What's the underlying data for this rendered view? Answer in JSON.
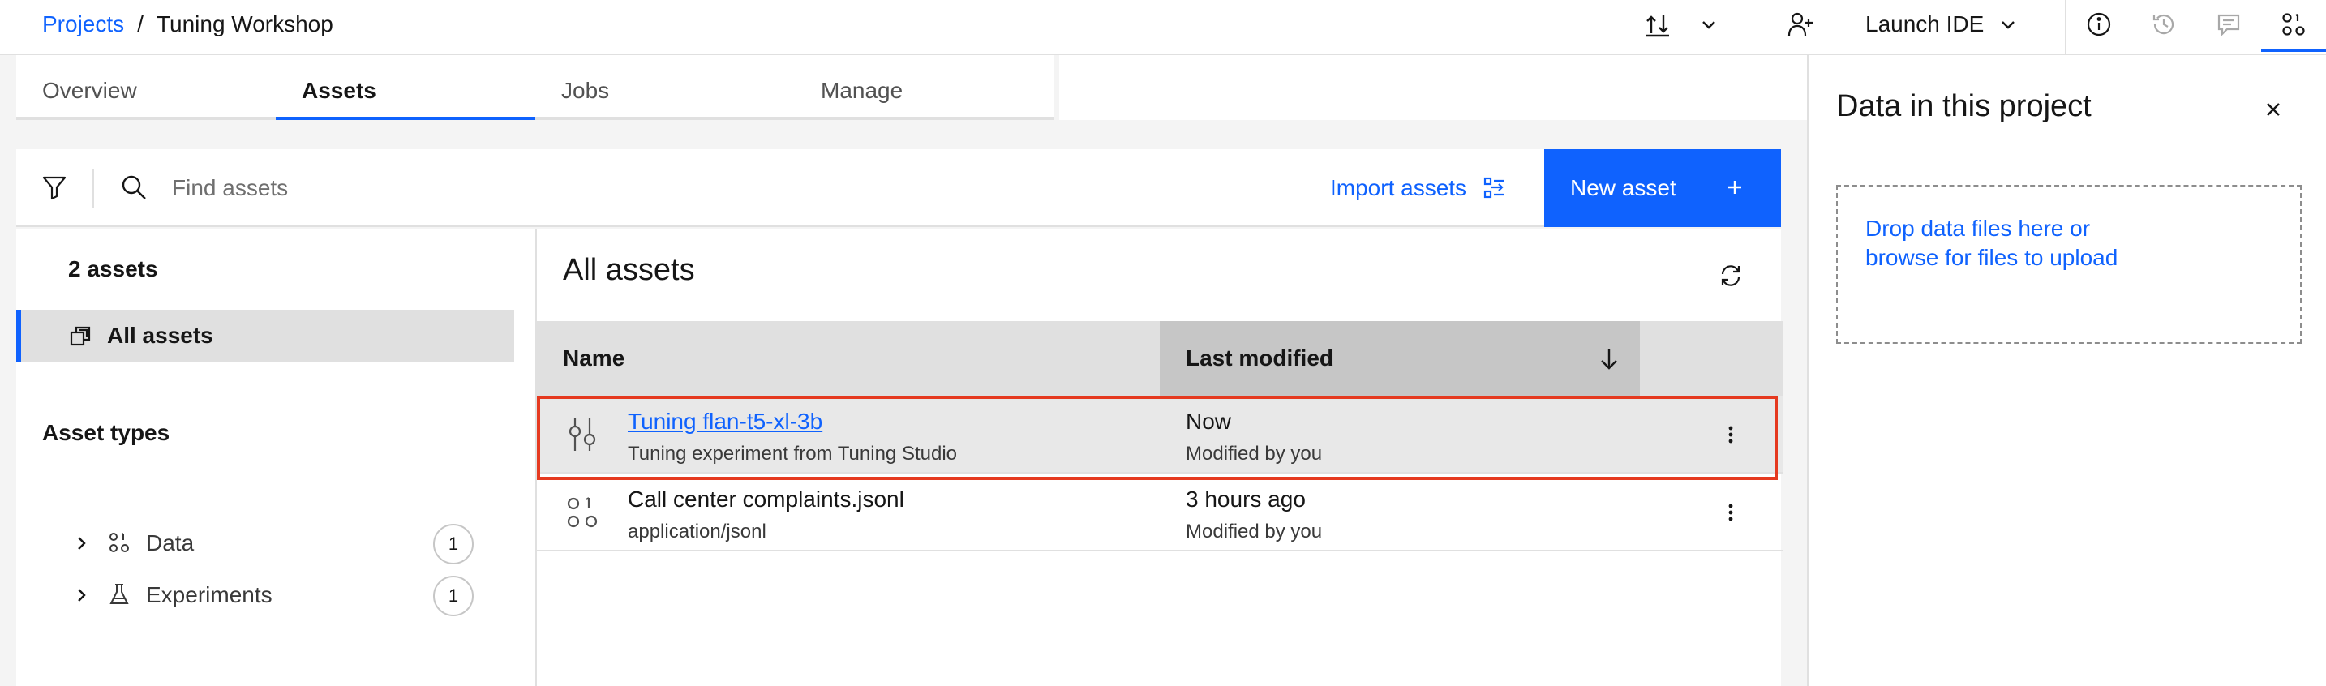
{
  "header": {
    "breadcrumb_root": "Projects",
    "breadcrumb_sep": "/",
    "project_name": "Tuning Workshop",
    "launch_label": "Launch IDE"
  },
  "tabs": [
    {
      "label": "Overview",
      "active": false
    },
    {
      "label": "Assets",
      "active": true
    },
    {
      "label": "Jobs",
      "active": false
    },
    {
      "label": "Manage",
      "active": false
    }
  ],
  "toolbar": {
    "search_placeholder": "Find assets",
    "import_label": "Import assets",
    "new_label": "New asset"
  },
  "sidebar": {
    "count": "2 assets",
    "all_assets": "All assets",
    "types_heading": "Asset types",
    "types": [
      {
        "label": "Data",
        "count": "1",
        "icon": "data-icon"
      },
      {
        "label": "Experiments",
        "count": "1",
        "icon": "flask-icon"
      }
    ]
  },
  "content": {
    "title": "All assets",
    "columns": {
      "name": "Name",
      "modified": "Last modified"
    },
    "rows": [
      {
        "name": "Tuning flan-t5-xl-3b",
        "subtitle": "Tuning experiment from Tuning Studio",
        "modified": "Now",
        "by": "Modified by you",
        "icon": "tuning-experiment-icon",
        "selected": true
      },
      {
        "name": "Call center complaints.jsonl",
        "subtitle": "application/jsonl",
        "modified": "3 hours ago",
        "by": "Modified by you",
        "icon": "data-icon",
        "selected": false
      }
    ]
  },
  "drawer": {
    "title": "Data in this project",
    "drop_line1": "Drop data files here or",
    "drop_line2": "browse for files to upload"
  },
  "colors": {
    "accent": "#0f62fe",
    "highlight": "#e5391f"
  }
}
